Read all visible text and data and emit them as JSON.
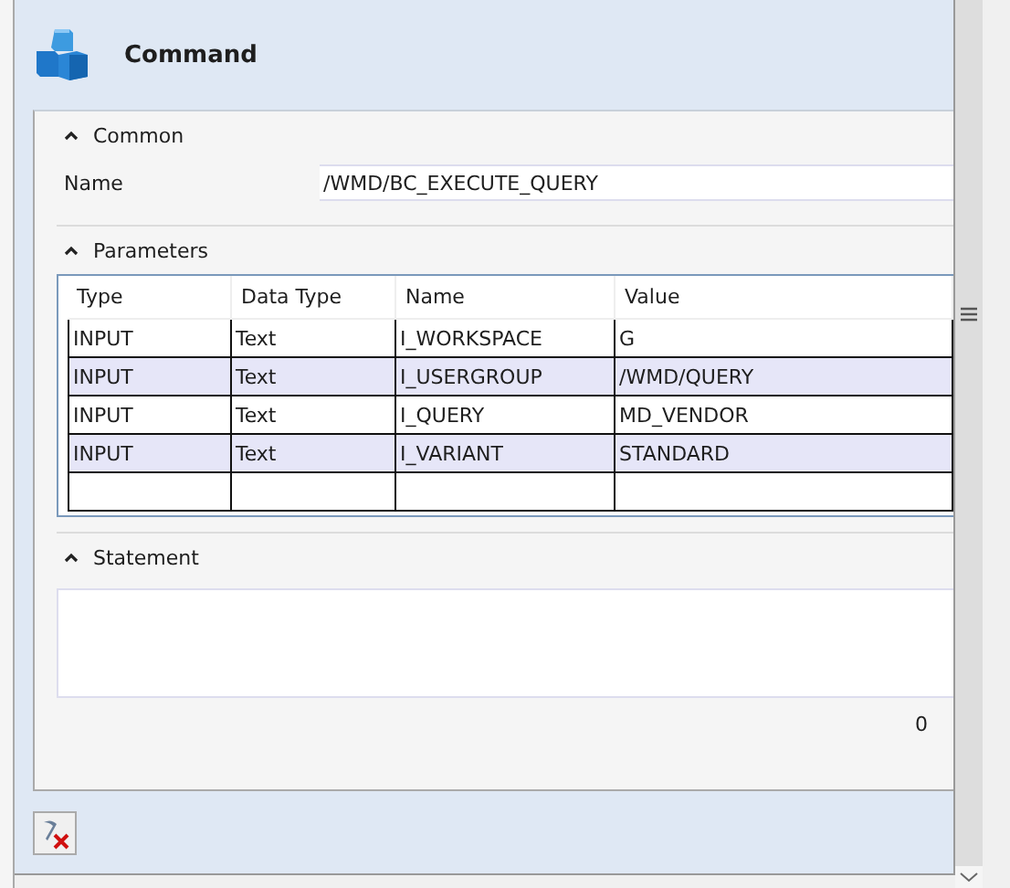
{
  "header": {
    "title": "Command"
  },
  "sections": [
    {
      "kind": "common",
      "label": "Common",
      "expanded": true
    },
    {
      "kind": "parameters",
      "label": "Parameters",
      "expanded": true
    },
    {
      "kind": "statement",
      "label": "Statement",
      "expanded": true
    }
  ],
  "common": {
    "name_label": "Name",
    "name_value": "/WMD/BC_EXECUTE_QUERY"
  },
  "parameters": {
    "columns": [
      "Type",
      "Data Type",
      "Name",
      "Value"
    ],
    "rows": [
      [
        "INPUT",
        "Text",
        "I_WORKSPACE",
        "G"
      ],
      [
        "INPUT",
        "Text",
        "I_USERGROUP",
        "/WMD/QUERY"
      ],
      [
        "INPUT",
        "Text",
        "I_QUERY",
        "MD_VENDOR"
      ],
      [
        "INPUT",
        "Text",
        "I_VARIANT",
        "STANDARD"
      ]
    ]
  },
  "statement": {
    "char_count": "0"
  }
}
